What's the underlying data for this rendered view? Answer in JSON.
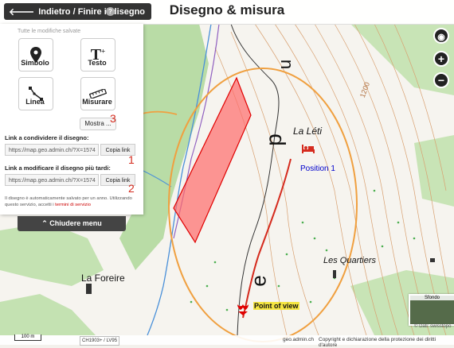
{
  "toolbar": {
    "back_label": "Indietro / Finire il disegno",
    "title": "Disegno & misura"
  },
  "panel": {
    "saved_text": "Tutte le modifiche salvate",
    "tools": [
      {
        "label": "Simbolo",
        "icon": "map-pin-icon"
      },
      {
        "label": "Testo",
        "icon": "text-add-icon"
      },
      {
        "label": "Linea",
        "icon": "line-icon"
      },
      {
        "label": "Misurare",
        "icon": "ruler-icon"
      }
    ],
    "more_label": "Mostra ...",
    "share_label": "Link a condividere il disegno:",
    "share_value": "https://map.geo.admin.ch/?X=1574",
    "edit_label": "Link a modificare il disegno più tardi:",
    "edit_value": "https://map.geo.admin.ch/?X=1574",
    "copy_label": "Copia link",
    "note_text": "Il disegno è automaticamente salvato per un anno. Utilizzando questo servizio, accetti i ",
    "terms_link": "termini di servizio",
    "close_label": "Chiudere menu"
  },
  "annotations": {
    "marker_1": "1",
    "marker_2": "2",
    "marker_3": "3"
  },
  "map": {
    "place_la_leti": "La Léti",
    "place_les_quartiers": "Les Quartiers",
    "place_la_foreire": "La Foreire",
    "contour_1200": "1200",
    "letter_u": "u",
    "letter_p": "p",
    "letter_e": "e",
    "position_label": "Position 1",
    "point_of_view_label": "Point of view"
  },
  "zoom": {
    "locate": "◉",
    "zoom_in": "+",
    "zoom_out": "−"
  },
  "bottom": {
    "scale_label": "100 m",
    "crs_label": "CH1903+ / LV95",
    "domain": "geo.admin.ch",
    "copyright": "Copyright e dichiarazione della protezione dei diritti d'autore",
    "background_label": "Sfondo",
    "attribution": "© Dati: swisstopo"
  },
  "colors": {
    "drawing_fill": "#ff6b6b",
    "drawing_stroke": "#e00000",
    "highlight_orange": "#f0a040",
    "label_red": "#d52b1e",
    "position_blue": "#0000cc"
  }
}
